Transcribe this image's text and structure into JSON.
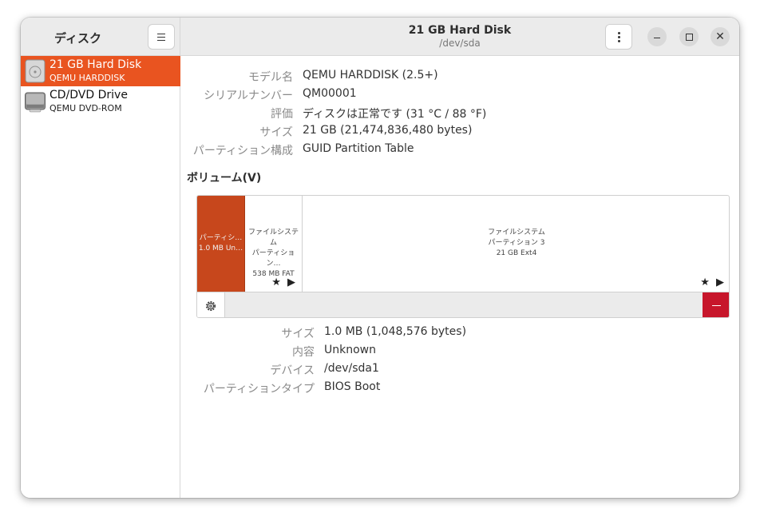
{
  "sidebar": {
    "title": "ディスク",
    "items": [
      {
        "title": "21 GB Hard Disk",
        "subtitle": "QEMU HARDDISK",
        "icon": "hard-disk-icon",
        "selected": true
      },
      {
        "title": "CD/DVD Drive",
        "subtitle": "QEMU DVD-ROM",
        "icon": "optical-drive-icon",
        "selected": false
      }
    ]
  },
  "header": {
    "title": "21 GB Hard Disk",
    "subtitle": "/dev/sda"
  },
  "disk_info": {
    "rows": [
      {
        "label": "モデル名",
        "value": "QEMU HARDDISK (2.5+)"
      },
      {
        "label": "シリアルナンバー",
        "value": "QM00001"
      },
      {
        "label": "評価",
        "value": "ディスクは正常です (31 °C / 88 °F)"
      },
      {
        "label": "サイズ",
        "value": "21 GB (21,474,836,480 bytes)"
      },
      {
        "label": "パーティション構成",
        "value": "GUID Partition Table"
      }
    ]
  },
  "volumes": {
    "heading": "ボリューム(V)",
    "segments": [
      {
        "line1": "パーティシ…",
        "line2": "1.0 MB Un…",
        "line3": "",
        "selected": true
      },
      {
        "line1": "ファイルシステム",
        "line2": "パーティション…",
        "line3": "538 MB FAT",
        "selected": false
      },
      {
        "line1": "ファイルシステム",
        "line2": "パーティション 3",
        "line3": "21 GB Ext4",
        "selected": false
      }
    ],
    "segment_icons": "★ ▶"
  },
  "partition_info": {
    "rows": [
      {
        "label": "サイズ",
        "value": "1.0 MB (1,048,576 bytes)"
      },
      {
        "label": "内容",
        "value": "Unknown"
      },
      {
        "label": "デバイス",
        "value": "/dev/sda1"
      },
      {
        "label": "パーティションタイプ",
        "value": "BIOS Boot"
      }
    ]
  },
  "colors": {
    "accent": "#e95420",
    "selected_partition": "#c7471c",
    "destructive": "#c7162b"
  }
}
